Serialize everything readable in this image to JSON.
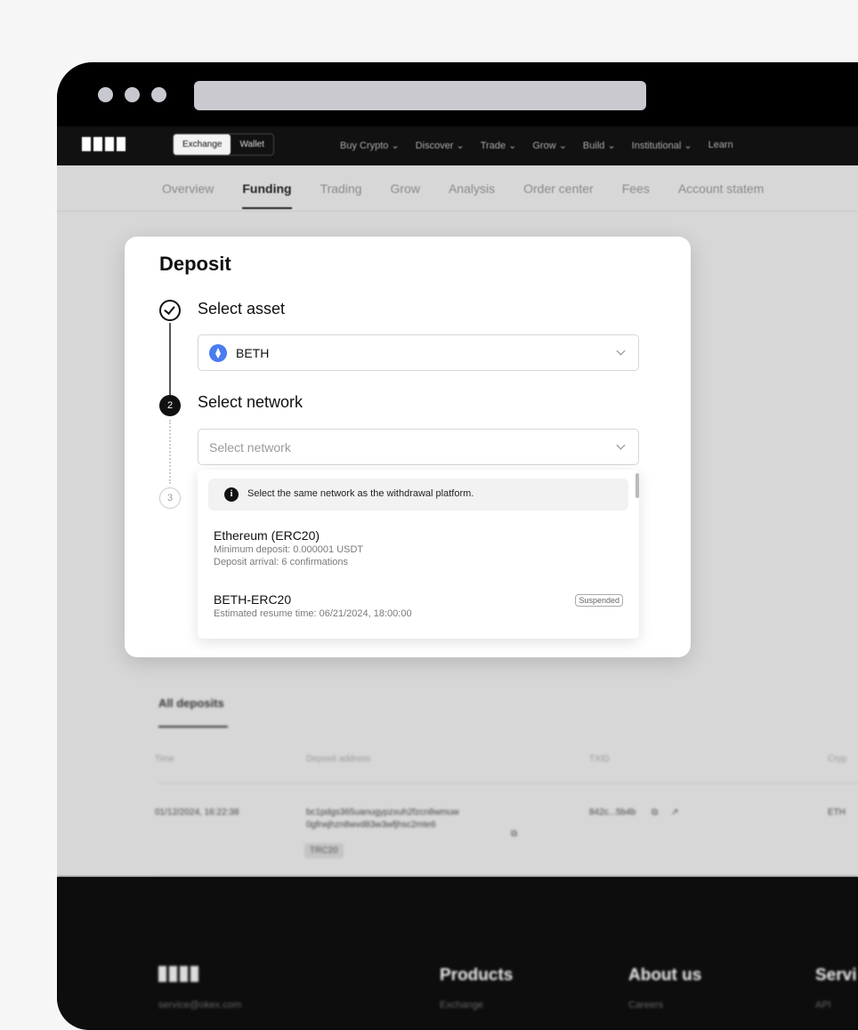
{
  "browser": {
    "window_controls": [
      "dot",
      "dot",
      "dot"
    ]
  },
  "navbar": {
    "segment": [
      "Exchange",
      "Wallet"
    ],
    "links": [
      "Buy Crypto ⌄",
      "Discover ⌄",
      "Trade ⌄",
      "Grow ⌄",
      "Build ⌄",
      "Institutional ⌄",
      "Learn"
    ]
  },
  "subnav": {
    "tabs": [
      "Overview",
      "Funding",
      "Trading",
      "Grow",
      "Analysis",
      "Order center",
      "Fees",
      "Account statem"
    ]
  },
  "deposits": {
    "title": "All deposits",
    "headers": [
      "Time",
      "Deposit address",
      "TXID",
      "Cryp"
    ],
    "row": {
      "time": "01/12/2024, 16:22:38",
      "address_line1": "bc1pdgs365uanugypzxuh2fzcn8wmuw",
      "address_line2": "0gfrwjhzn8wvd83w3wfjhsc2mte6",
      "network_tag": "TRC20",
      "txid": "842c...5b4b",
      "crypto": "ETH"
    }
  },
  "footer": {
    "columns": [
      "Products",
      "About us",
      "Servi"
    ],
    "subs": [
      "service@okex.com",
      "Exchange",
      "Careers",
      "API"
    ]
  },
  "modal": {
    "title": "Deposit",
    "step1_label": "Select asset",
    "asset_value": "BETH",
    "step2_number": "2",
    "step2_label": "Select network",
    "network_placeholder": "Select network",
    "step3_number": "3",
    "info": "Select the same network as the withdrawal platform.",
    "options": [
      {
        "name": "Ethereum (ERC20)",
        "sub1": "Minimum deposit: 0.000001 USDT",
        "sub2": "Deposit arrival: 6 confirmations"
      },
      {
        "name": "BETH-ERC20",
        "sub1": "Estimated resume time: 06/21/2024, 18:00:00",
        "badge": "Suspended"
      }
    ]
  }
}
